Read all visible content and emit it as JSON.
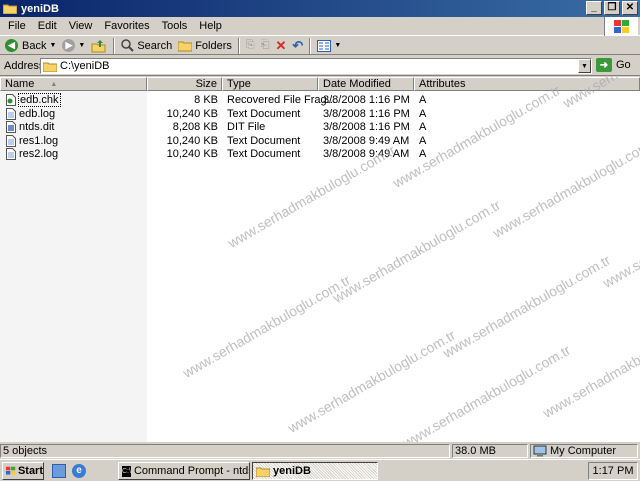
{
  "window": {
    "title": "yeniDB"
  },
  "menu": [
    "File",
    "Edit",
    "View",
    "Favorites",
    "Tools",
    "Help"
  ],
  "toolbar": {
    "back": "Back",
    "search": "Search",
    "folders": "Folders"
  },
  "address": {
    "label": "Address",
    "value": "C:\\yeniDB",
    "go": "Go"
  },
  "columns": {
    "name": "Name",
    "size": "Size",
    "type": "Type",
    "date": "Date Modified",
    "attributes": "Attributes"
  },
  "files": [
    {
      "name": "edb.chk",
      "size": "8 KB",
      "type": "Recovered File Frag...",
      "date": "3/8/2008 1:16 PM",
      "attr": "A",
      "icon": "chk-file-icon"
    },
    {
      "name": "edb.log",
      "size": "10,240 KB",
      "type": "Text Document",
      "date": "3/8/2008 1:16 PM",
      "attr": "A",
      "icon": "text-file-icon"
    },
    {
      "name": "ntds.dit",
      "size": "8,208 KB",
      "type": "DIT File",
      "date": "3/8/2008 1:16 PM",
      "attr": "A",
      "icon": "dit-file-icon"
    },
    {
      "name": "res1.log",
      "size": "10,240 KB",
      "type": "Text Document",
      "date": "3/8/2008 9:49 AM",
      "attr": "A",
      "icon": "text-file-icon"
    },
    {
      "name": "res2.log",
      "size": "10,240 KB",
      "type": "Text Document",
      "date": "3/8/2008 9:49 AM",
      "attr": "A",
      "icon": "text-file-icon"
    }
  ],
  "status": {
    "objects": "5 objects",
    "size": "38.0 MB",
    "location": "My Computer"
  },
  "taskbar": {
    "start": "Start",
    "tasks": [
      "Command Prompt - ntdsutil",
      "yeniDB"
    ],
    "clock": "1:17 PM"
  },
  "watermark": "www.serhadmakbuloglu.com.tr",
  "colors": {
    "titlebar_start": "#0a246a",
    "titlebar_end": "#3a6ea5",
    "face": "#d4d0c8"
  }
}
